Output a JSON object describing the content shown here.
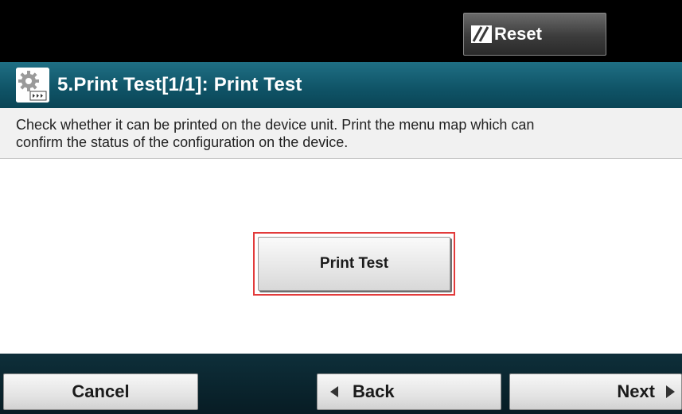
{
  "header": {
    "reset_label": "Reset",
    "reset_icon": "reset-icon"
  },
  "title_bar": {
    "icon": "settings-gear-icon",
    "title": "5.Print Test[1/1]: Print Test"
  },
  "description": {
    "line1": "Check whether it can be printed on the device unit. Print the menu map which can",
    "line2": "confirm the status of the configuration on the device."
  },
  "main": {
    "print_test_label": "Print Test",
    "highlight_color": "#e23b3b"
  },
  "footer": {
    "cancel_label": "Cancel",
    "back_label": "Back",
    "next_label": "Next",
    "back_icon": "triangle-left-icon",
    "next_icon": "triangle-right-icon"
  },
  "colors": {
    "title_bar": "#0f5366",
    "top_bar": "#000000",
    "bottom_bar": "#0b2630"
  }
}
